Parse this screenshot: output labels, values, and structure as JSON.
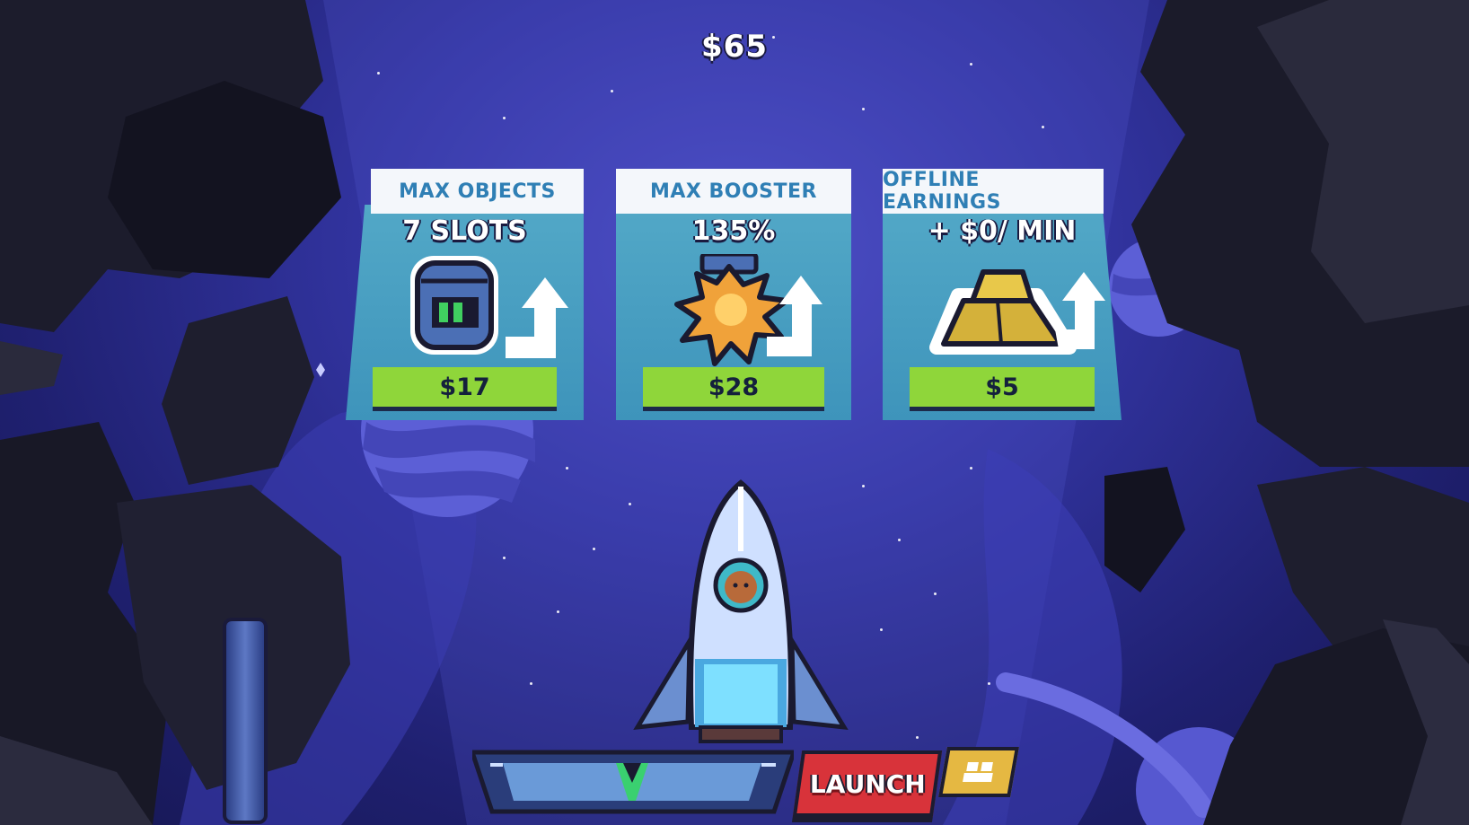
{
  "balance": "$65",
  "upgrades": [
    {
      "title": "MAX OBJECTS",
      "value": "7 SLOTS",
      "price": "$17",
      "icon": "storage-slots-icon"
    },
    {
      "title": "MAX BOOSTER",
      "value": "135%",
      "price": "$28",
      "icon": "booster-flame-icon"
    },
    {
      "title": "OFFLINE EARNINGS",
      "value": "+ $0/ MIN",
      "price": "$5",
      "icon": "gold-bars-icon"
    }
  ],
  "launch_label": "LAUNCH",
  "colors": {
    "card_panel": "#4aa0c4",
    "card_tab": "#f4f7fb",
    "title_text": "#2f7fb5",
    "price_bar": "#8fd63a",
    "launch_button": "#d8333a",
    "extra_button": "#e5b842"
  }
}
